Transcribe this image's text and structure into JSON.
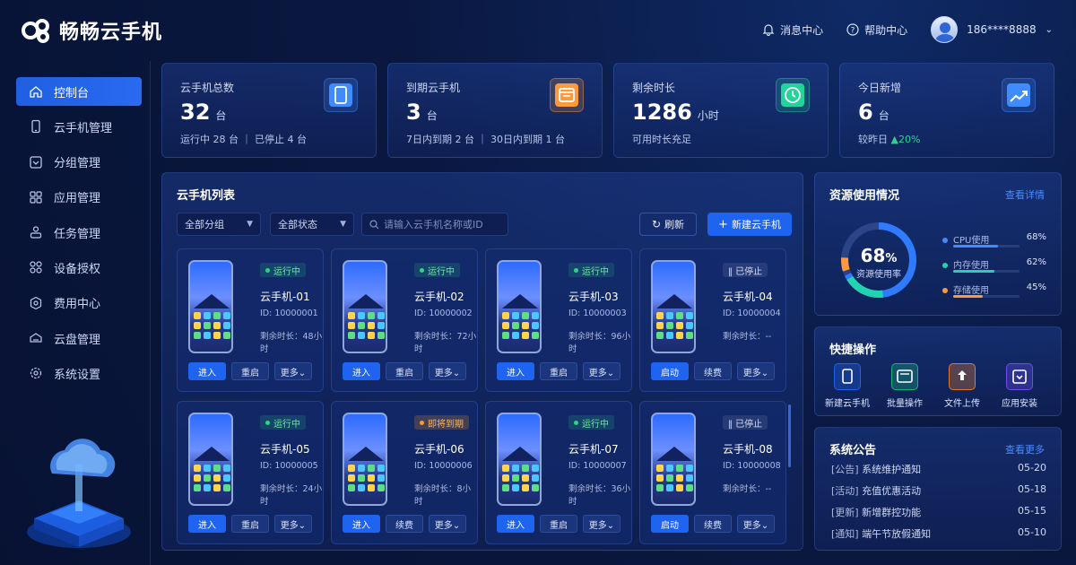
{
  "brand": {
    "name": "畅畅云手机"
  },
  "header": {
    "messages": "消息中心",
    "help": "帮助中心",
    "user": "186****8888"
  },
  "sidebar": {
    "items": [
      {
        "label": "控制台",
        "icon": "home-icon",
        "active": true
      },
      {
        "label": "云手机管理",
        "icon": "phone-icon"
      },
      {
        "label": "分组管理",
        "icon": "group-icon"
      },
      {
        "label": "应用管理",
        "icon": "apps-icon"
      },
      {
        "label": "任务管理",
        "icon": "task-icon"
      },
      {
        "label": "设备授权",
        "icon": "authorize-icon"
      },
      {
        "label": "费用中心",
        "icon": "billing-icon"
      },
      {
        "label": "云盘管理",
        "icon": "cloud-disk-icon"
      },
      {
        "label": "系统设置",
        "icon": "settings-icon"
      }
    ]
  },
  "stats": [
    {
      "label": "云手机总数",
      "value": "32",
      "unit": "台",
      "sub": "运行中 28 台 ｜ 已停止 4 台",
      "icon": "tablet-icon",
      "color": "#3f8bff"
    },
    {
      "label": "到期云手机",
      "value": "3",
      "unit": "台",
      "sub": "7日内到期 2 台 ｜ 30日内到期 1 台",
      "icon": "calendar-icon",
      "color": "#ff9a3c"
    },
    {
      "label": "剩余时长",
      "value": "1286",
      "unit": "小时",
      "sub": "可用时长充足",
      "icon": "clock-icon",
      "color": "#22d39a"
    },
    {
      "label": "今日新增",
      "value": "6",
      "unit": "台",
      "sub_prefix": "较昨日",
      "sub_change": "▲20%",
      "icon": "trend-up-icon",
      "color": "#3f8bff"
    }
  ],
  "list": {
    "title": "云手机列表",
    "filter_group": "全部分组",
    "filter_status": "全部状态",
    "search_placeholder": "请输入云手机名称或ID",
    "refresh_label": "刷新",
    "new_label": "新建云手机",
    "phones": [
      {
        "status": "运行中",
        "kind": "run",
        "name": "云手机-01",
        "id": "ID: 10000001",
        "remain": "剩余时长：48小时",
        "b1": "进入",
        "b2": "重启",
        "b3": "更多⌄"
      },
      {
        "status": "运行中",
        "kind": "run",
        "name": "云手机-02",
        "id": "ID: 10000002",
        "remain": "剩余时长：72小时",
        "b1": "进入",
        "b2": "重启",
        "b3": "更多⌄"
      },
      {
        "status": "运行中",
        "kind": "run",
        "name": "云手机-03",
        "id": "ID: 10000003",
        "remain": "剩余时长：96小时",
        "b1": "进入",
        "b2": "重启",
        "b3": "更多⌄"
      },
      {
        "status": "‖ 已停止",
        "kind": "stop",
        "name": "云手机-04",
        "id": "ID: 10000004",
        "remain": "剩余时长：--",
        "b1": "启动",
        "b2": "续费",
        "b3": "更多⌄"
      },
      {
        "status": "运行中",
        "kind": "run",
        "name": "云手机-05",
        "id": "ID: 10000005",
        "remain": "剩余时长：24小时",
        "b1": "进入",
        "b2": "重启",
        "b3": "更多⌄"
      },
      {
        "status": "即将到期",
        "kind": "warn",
        "name": "云手机-06",
        "id": "ID: 10000006",
        "remain": "剩余时长：8小时",
        "b1": "进入",
        "b2": "续费",
        "b3": "更多⌄"
      },
      {
        "status": "运行中",
        "kind": "run",
        "name": "云手机-07",
        "id": "ID: 10000007",
        "remain": "剩余时长：36小时",
        "b1": "进入",
        "b2": "重启",
        "b3": "更多⌄"
      },
      {
        "status": "‖ 已停止",
        "kind": "stop",
        "name": "云手机-08",
        "id": "ID: 10000008",
        "remain": "剩余时长：--",
        "b1": "启动",
        "b2": "续费",
        "b3": "更多⌄"
      }
    ]
  },
  "resources": {
    "title": "资源使用情况",
    "link": "查看详情",
    "gauge_value": "68",
    "gauge_unit": "%",
    "gauge_label": "资源使用率",
    "items": [
      {
        "label": "CPU使用",
        "pct": "68%",
        "value": 0.68,
        "color": "#3f8bff"
      },
      {
        "label": "内存使用",
        "pct": "62%",
        "value": 0.62,
        "color": "#22d3b0"
      },
      {
        "label": "存储使用",
        "pct": "45%",
        "value": 0.45,
        "color": "#ff9a3c"
      }
    ]
  },
  "quick": {
    "title": "快捷操作",
    "items": [
      {
        "label": "新建云手机",
        "icon": "new-phone-icon",
        "color": "#1f64f0"
      },
      {
        "label": "批量操作",
        "icon": "batch-icon",
        "color": "#18b37a"
      },
      {
        "label": "文件上传",
        "icon": "upload-icon",
        "color": "#e07a2a"
      },
      {
        "label": "应用安装",
        "icon": "install-icon",
        "color": "#6d4cf0"
      }
    ]
  },
  "notices": {
    "title": "系统公告",
    "link": "查看更多",
    "items": [
      {
        "tag": "[公告]",
        "text": "系统维护通知",
        "date": "05-20"
      },
      {
        "tag": "[活动]",
        "text": "充值优惠活动",
        "date": "05-18"
      },
      {
        "tag": "[更新]",
        "text": "新增群控功能",
        "date": "05-15"
      },
      {
        "tag": "[通知]",
        "text": "端午节放假通知",
        "date": "05-10"
      }
    ]
  }
}
